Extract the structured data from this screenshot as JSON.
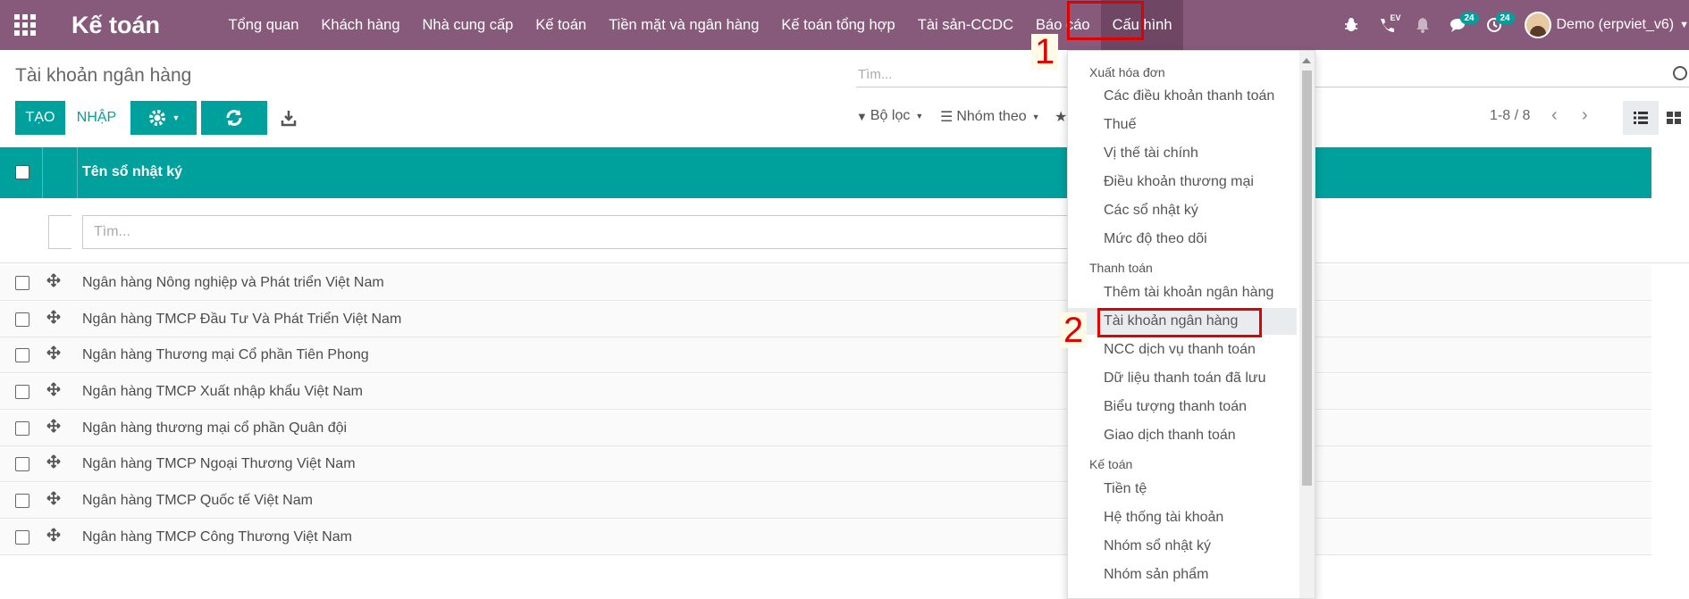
{
  "navbar": {
    "brand": "Kế toán",
    "menu": [
      {
        "label": "Tổng quan"
      },
      {
        "label": "Khách hàng"
      },
      {
        "label": "Nhà cung cấp"
      },
      {
        "label": "Kế toán"
      },
      {
        "label": "Tiền mặt và ngân hàng"
      },
      {
        "label": "Kế toán tổng hợp"
      },
      {
        "label": "Tài sản-CCDC"
      },
      {
        "label": "Báo cáo"
      },
      {
        "label": "Cấu hình"
      }
    ],
    "icons": {
      "debug": "bug-icon",
      "ev": "phone-icon",
      "ev_label": "EV",
      "notifications": "bell-icon",
      "messages": "chat-icon",
      "activities": "clock-icon"
    },
    "messages_count": "24",
    "activities_count": "24",
    "user_name": "Demo (erpviet_v6)"
  },
  "control_panel": {
    "breadcrumb": "Tài khoản ngân hàng",
    "search_placeholder": "Tìm...",
    "create_label": "TẠO",
    "import_label": "NHẬP",
    "filters_label": "Bộ lọc",
    "group_by_label": "Nhóm theo",
    "pager": "1-8 / 8"
  },
  "list": {
    "column_name": "Tên sổ nhật ký",
    "filter_placeholder": "Tìm...",
    "rows": [
      {
        "name": "Ngân hàng Nông nghiệp và Phát triển Việt Nam"
      },
      {
        "name": "Ngân hàng TMCP Đầu Tư Và Phát Triển Việt Nam"
      },
      {
        "name": "Ngân hàng Thương mại Cổ phần Tiên Phong"
      },
      {
        "name": "Ngân hàng TMCP Xuất nhập khẩu Việt Nam"
      },
      {
        "name": "Ngân hàng thương mại cổ phần Quân đội"
      },
      {
        "name": "Ngân hàng TMCP Ngoại Thương Việt Nam"
      },
      {
        "name": "Ngân hàng TMCP Quốc tế Việt Nam"
      },
      {
        "name": "Ngân hàng TMCP Công Thương Việt Nam"
      }
    ]
  },
  "dropdown": {
    "sections": [
      {
        "header": "Xuất hóa đơn",
        "items": [
          {
            "label": "Các điều khoản thanh toán"
          },
          {
            "label": "Thuế"
          },
          {
            "label": "Vị thế tài chính"
          },
          {
            "label": "Điều khoản thương mại"
          },
          {
            "label": "Các sổ nhật ký"
          },
          {
            "label": "Mức độ theo dõi"
          }
        ]
      },
      {
        "header": "Thanh toán",
        "items": [
          {
            "label": "Thêm tài khoản ngân hàng"
          },
          {
            "label": "Tài khoản ngân hàng"
          },
          {
            "label": "NCC dịch vụ thanh toán"
          },
          {
            "label": "Dữ liệu thanh toán đã lưu"
          },
          {
            "label": "Biểu tượng thanh toán"
          },
          {
            "label": "Giao dịch thanh toán"
          }
        ]
      },
      {
        "header": "Kế toán",
        "items": [
          {
            "label": "Tiền tệ"
          },
          {
            "label": "Hệ thống tài khoản"
          },
          {
            "label": "Nhóm sổ nhật ký"
          },
          {
            "label": "Nhóm sản phẩm"
          }
        ]
      }
    ]
  },
  "annotations": {
    "step1": "1",
    "step2": "2",
    "color": "#e00000"
  },
  "colors": {
    "navbar": "#875a7b",
    "primary": "#00a09d"
  }
}
